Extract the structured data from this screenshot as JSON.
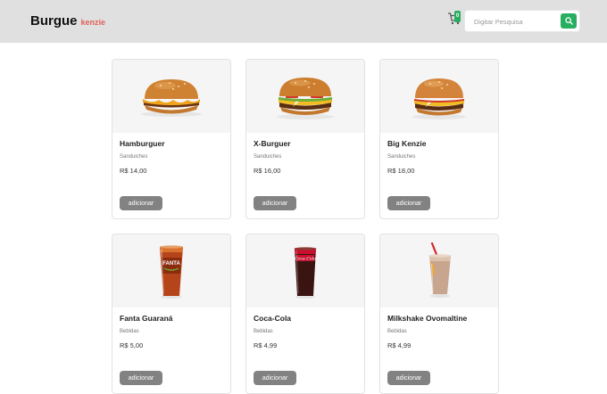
{
  "header": {
    "logo_main": "Burgue",
    "logo_sub": "kenzie",
    "cart_count": "0",
    "search_placeholder": "Digitar Pesquisa"
  },
  "products": [
    {
      "name": "Hamburguer",
      "category": "Sanduiches",
      "price": "R$ 14,00",
      "button": "adicionar",
      "image": "hamburger"
    },
    {
      "name": "X-Burguer",
      "category": "Sanduiches",
      "price": "R$ 16,00",
      "button": "adicionar",
      "image": "cheeseburger"
    },
    {
      "name": "Big Kenzie",
      "category": "Sanduiches",
      "price": "R$ 18,00",
      "button": "adicionar",
      "image": "big-burger"
    },
    {
      "name": "Fanta Guaraná",
      "category": "Bebidas",
      "price": "R$ 5,00",
      "button": "adicionar",
      "image": "fanta-cup"
    },
    {
      "name": "Coca-Cola",
      "category": "Bebidas",
      "price": "R$ 4,99",
      "button": "adicionar",
      "image": "coca-cola-cup"
    },
    {
      "name": "Milkshake Ovomaltine",
      "category": "Bebidas",
      "price": "R$ 4,99",
      "button": "adicionar",
      "image": "milkshake"
    }
  ],
  "colors": {
    "accent": "#27ae60",
    "logo_accent": "#e0605a",
    "header_bg": "#e0e0e0",
    "button_bg": "#828282"
  }
}
